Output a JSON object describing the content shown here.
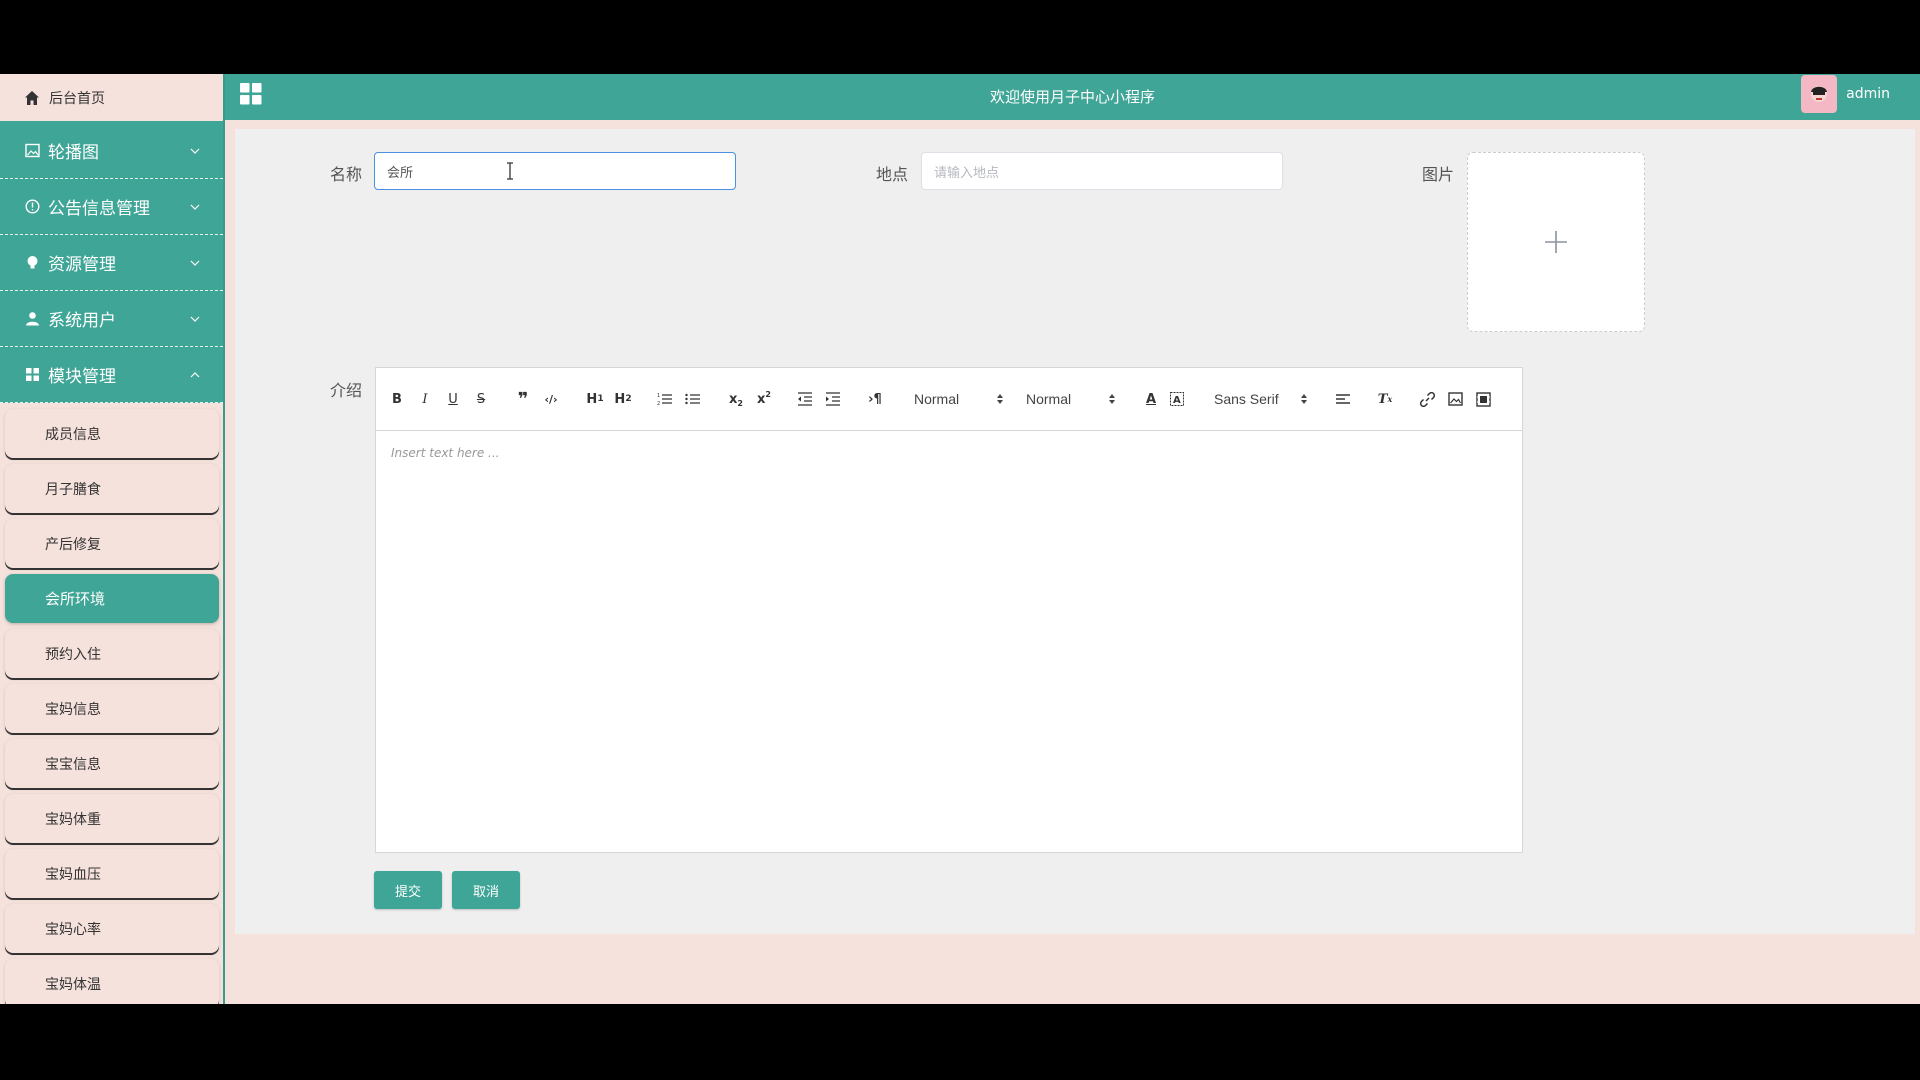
{
  "header": {
    "title": "欢迎使用月子中心小程序",
    "username": "admin"
  },
  "sidebar": {
    "home": "后台首页",
    "menus": [
      {
        "label": "轮播图",
        "icon": "picture-icon",
        "expanded": false
      },
      {
        "label": "公告信息管理",
        "icon": "info-circle-icon",
        "expanded": false
      },
      {
        "label": "资源管理",
        "icon": "bulb-icon",
        "expanded": false
      },
      {
        "label": "系统用户",
        "icon": "user-icon",
        "expanded": false
      },
      {
        "label": "模块管理",
        "icon": "grid-icon",
        "expanded": true
      }
    ],
    "sub_items": [
      "成员信息",
      "月子膳食",
      "产后修复",
      "会所环境",
      "预约入住",
      "宝妈信息",
      "宝宝信息",
      "宝妈体重",
      "宝妈血压",
      "宝妈心率",
      "宝妈体温"
    ],
    "active_sub_item": "会所环境"
  },
  "form": {
    "name_label": "名称",
    "name_value": "会所",
    "location_label": "地点",
    "location_placeholder": "请输入地点",
    "image_label": "图片",
    "intro_label": "介绍",
    "editor": {
      "header_select": "Normal",
      "size_select": "Normal",
      "font_select": "Sans Serif",
      "placeholder": "Insert text here ..."
    },
    "submit_label": "提交",
    "cancel_label": "取消"
  },
  "colors": {
    "primary": "#3fa596",
    "background": "#f6e2dc",
    "panel": "#efefef"
  }
}
